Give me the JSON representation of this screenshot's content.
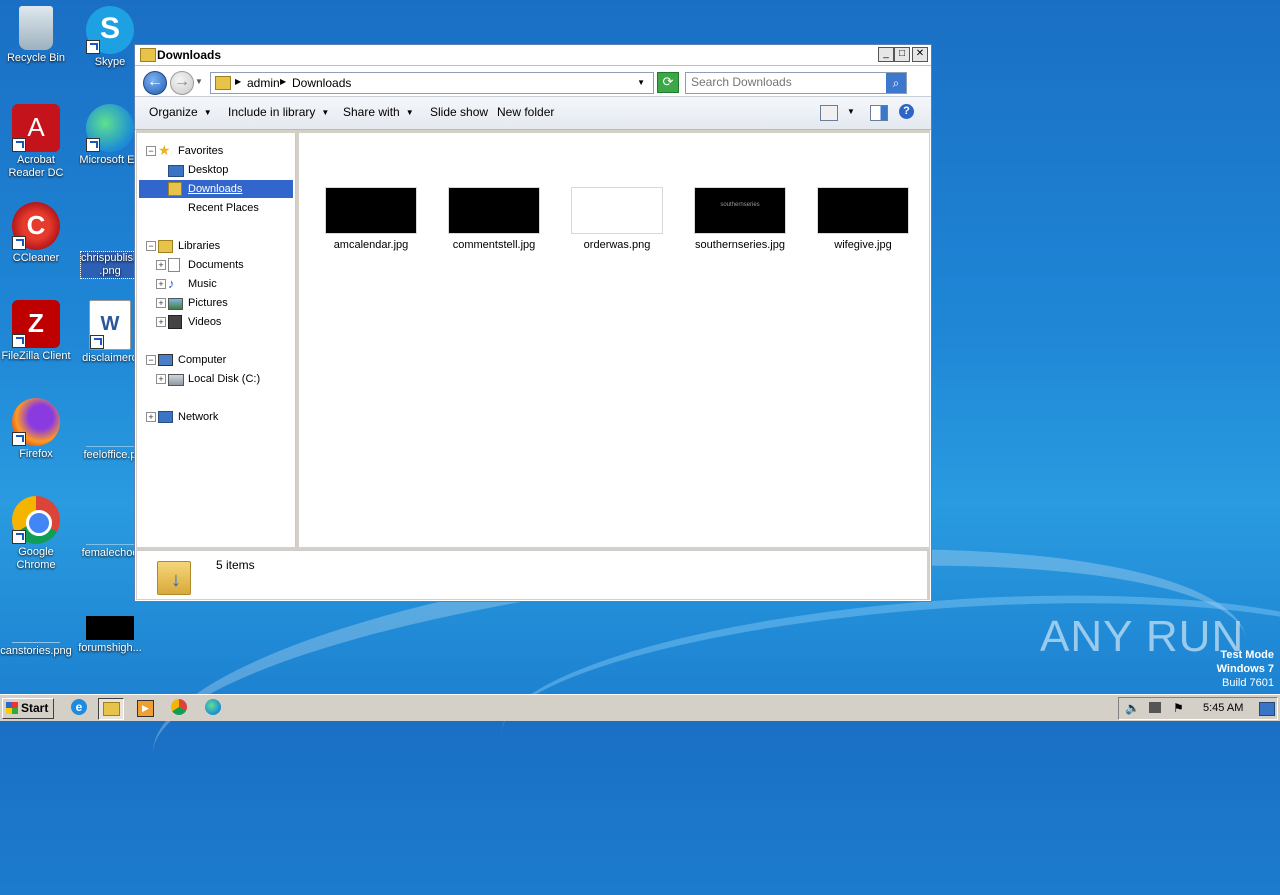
{
  "desktop": {
    "icons": [
      {
        "label": "Recycle Bin",
        "icon": "recycle-bin-icon"
      },
      {
        "label": "Skype",
        "icon": "skype-icon"
      },
      {
        "label": "Acrobat Reader DC",
        "icon": "acrobat-icon"
      },
      {
        "label": "Microsoft Ed",
        "icon": "edge-icon"
      },
      {
        "label": "CCleaner",
        "icon": "ccleaner-icon"
      },
      {
        "label": "chrispublishi .png",
        "icon": "png-file-icon"
      },
      {
        "label": "FileZilla Client",
        "icon": "filezilla-icon"
      },
      {
        "label": "disclaimerq",
        "icon": "word-doc-icon"
      },
      {
        "label": "Firefox",
        "icon": "firefox-icon"
      },
      {
        "label": "feeloffice.p",
        "icon": "image-file-icon"
      },
      {
        "label": "Google Chrome",
        "icon": "chrome-icon"
      },
      {
        "label": "femalechoo",
        "icon": "image-file-icon"
      },
      {
        "label": "canstories.png",
        "icon": "image-file-icon"
      },
      {
        "label": "forumshigh...",
        "icon": "image-file-icon"
      }
    ]
  },
  "window": {
    "title": "Downloads",
    "controls": {
      "minimize": "_",
      "maximize": "□",
      "close": "✕"
    },
    "address": {
      "crumbs": [
        "admin",
        "Downloads"
      ]
    },
    "search": {
      "placeholder": "Search Downloads"
    },
    "toolbar": {
      "organize": "Organize",
      "include_in_library": "Include in library",
      "share_with": "Share with",
      "slide_show": "Slide show",
      "new_folder": "New folder",
      "help": "?"
    },
    "nav": {
      "favorites": "Favorites",
      "desktop": "Desktop",
      "downloads": "Downloads",
      "recent_places": "Recent Places",
      "libraries": "Libraries",
      "documents": "Documents",
      "music": "Music",
      "pictures": "Pictures",
      "videos": "Videos",
      "computer": "Computer",
      "local_disk": "Local Disk (C:)",
      "network": "Network"
    },
    "files": [
      {
        "name": "amcalendar.jpg",
        "thumb_text": "",
        "dark": true
      },
      {
        "name": "commentstell.jpg",
        "thumb_text": "",
        "dark": true
      },
      {
        "name": "orderwas.png",
        "thumb_text": "",
        "dark": false
      },
      {
        "name": "southernseries.jpg",
        "thumb_text": "southernseries",
        "dark": true
      },
      {
        "name": "wifegive.jpg",
        "thumb_text": "",
        "dark": true
      }
    ],
    "status": {
      "items_count": "5 items"
    }
  },
  "watermark": {
    "brand": "ANY RUN",
    "line1": "Test Mode",
    "line2": "Windows 7",
    "line3": "Build 7601"
  },
  "taskbar": {
    "start": "Start",
    "clock": "5:45 AM"
  },
  "colors": {
    "selection": "#3366cc",
    "desktop": "#1f86d6"
  }
}
